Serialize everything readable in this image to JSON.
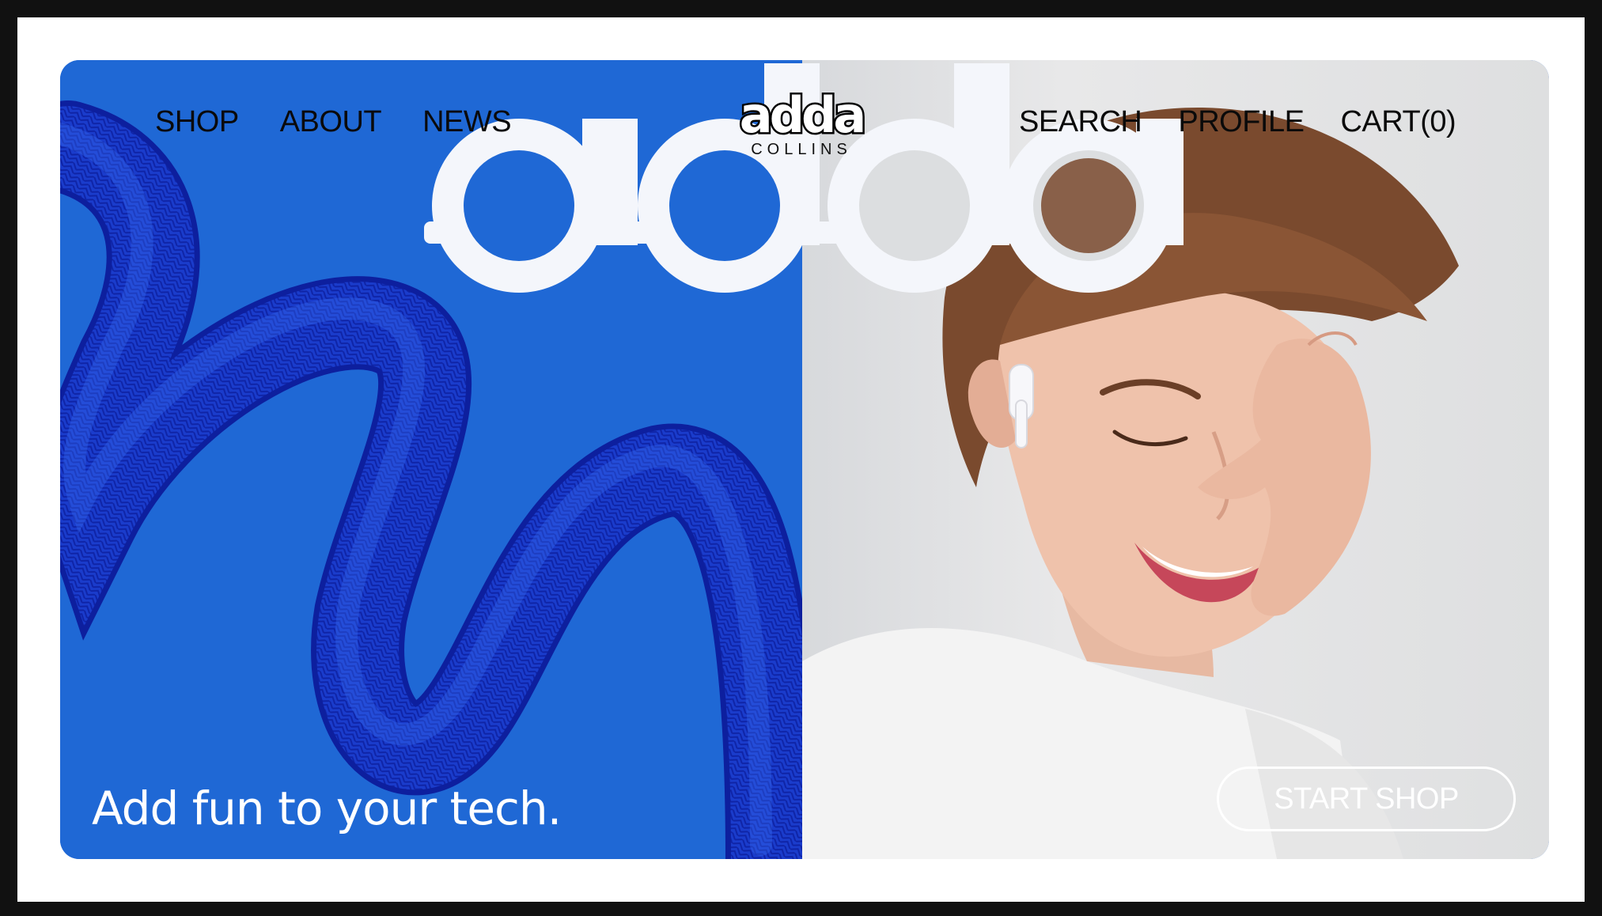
{
  "nav": {
    "left": [
      "SHOP",
      "ABOUT",
      "NEWS"
    ],
    "right": [
      "SEARCH",
      "PROFILE",
      "CART(0)"
    ]
  },
  "brand": {
    "word": "adda",
    "sub": "COLLINS"
  },
  "hero": {
    "tagline": "Add fun to your tech.",
    "cta": "START SHOP"
  },
  "colors": {
    "accent_blue": "#1f68d5",
    "cable_blue": "#1533c8",
    "white": "#ffffff",
    "text_dark": "#0a0a0a"
  }
}
